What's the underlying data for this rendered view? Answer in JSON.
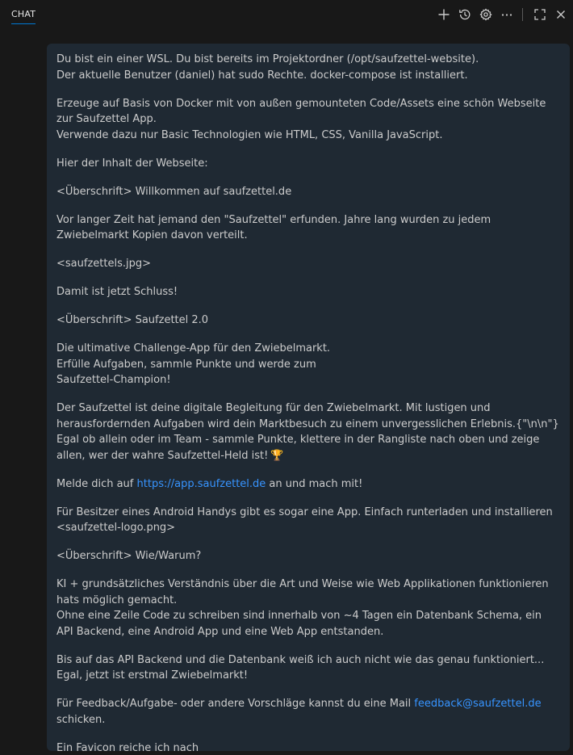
{
  "header": {
    "tab_label": "CHAT"
  },
  "message": {
    "p1": "Du bist ein einer WSL. Du bist bereits im Projektordner (/opt/saufzettel-website).\nDer aktuelle Benutzer (daniel) hat sudo Rechte. docker-compose ist installiert.",
    "p2": "Erzeuge auf Basis von Docker mit von außen gemounteten Code/Assets eine schön Webseite zur Saufzettel App.\nVerwende dazu nur Basic Technologien wie HTML, CSS, Vanilla JavaScript.",
    "p3": "Hier der Inhalt der Webseite:",
    "p4": "<Überschrift> Willkommen auf saufzettel.de",
    "p5": "Vor langer Zeit hat jemand den \"Saufzettel\" erfunden. Jahre lang wurden zu jedem Zwiebelmarkt Kopien davon verteilt.",
    "p6": "<saufzettels.jpg>",
    "p7": "Damit ist jetzt Schluss!",
    "p8": "<Überschrift> Saufzettel 2.0",
    "p9": "Die ultimative Challenge-App für den Zwiebelmarkt.\nErfülle Aufgaben, sammle Punkte und werde zum\nSaufzettel-Champion!",
    "p10": "Der Saufzettel ist deine digitale Begleitung für den Zwiebelmarkt. Mit lustigen und herausfordernden Aufgaben wird dein Marktbesuch zu einem unvergesslichen Erlebnis.{\"\\n\\n\"}\nEgal ob allein oder im Team - sammle Punkte, klettere in der Rangliste nach oben und zeige allen, wer der wahre Saufzettel-Held ist!",
    "trophy": "🏆",
    "p11_before": "Melde dich auf ",
    "p11_link": "https://app.saufzettel.de",
    "p11_after": " an und mach mit!",
    "p12": "Für Besitzer eines Android Handys gibt es sogar eine App. Einfach runterladen und installieren\n<saufzettel-logo.png>",
    "p13": "<Überschrift> Wie/Warum?",
    "p14": "KI + grundsätzliches Verständnis über die Art und Weise wie Web Applikationen funktionieren hats möglich gemacht.\nOhne eine Zeile Code zu schreiben sind innerhalb von ~4 Tagen ein Datenbank Schema, ein API Backend, eine Android App und eine Web App entstanden.",
    "p15": "Bis auf das API Backend und die Datenbank weiß ich auch nicht wie das genau funktioniert... Egal, jetzt ist erstmal Zwiebelmarkt!",
    "p16_before": "Für Feedback/Aufgabe- oder andere Vorschläge kannst du eine Mail ",
    "p16_link": "feedback@saufzettel.de",
    "p16_after": " schicken.",
    "p17": "Ein Favicon reiche ich nach"
  },
  "icons": {
    "new_chat": "plus-icon",
    "history": "history-icon",
    "settings": "gear-icon",
    "more": "ellipsis-icon",
    "maximize": "maximize-icon",
    "close": "close-icon"
  },
  "colors": {
    "background": "#181818",
    "bubble": "#1f2933",
    "text": "#cccccc",
    "link": "#3794ff",
    "accent": "#0078d4"
  }
}
